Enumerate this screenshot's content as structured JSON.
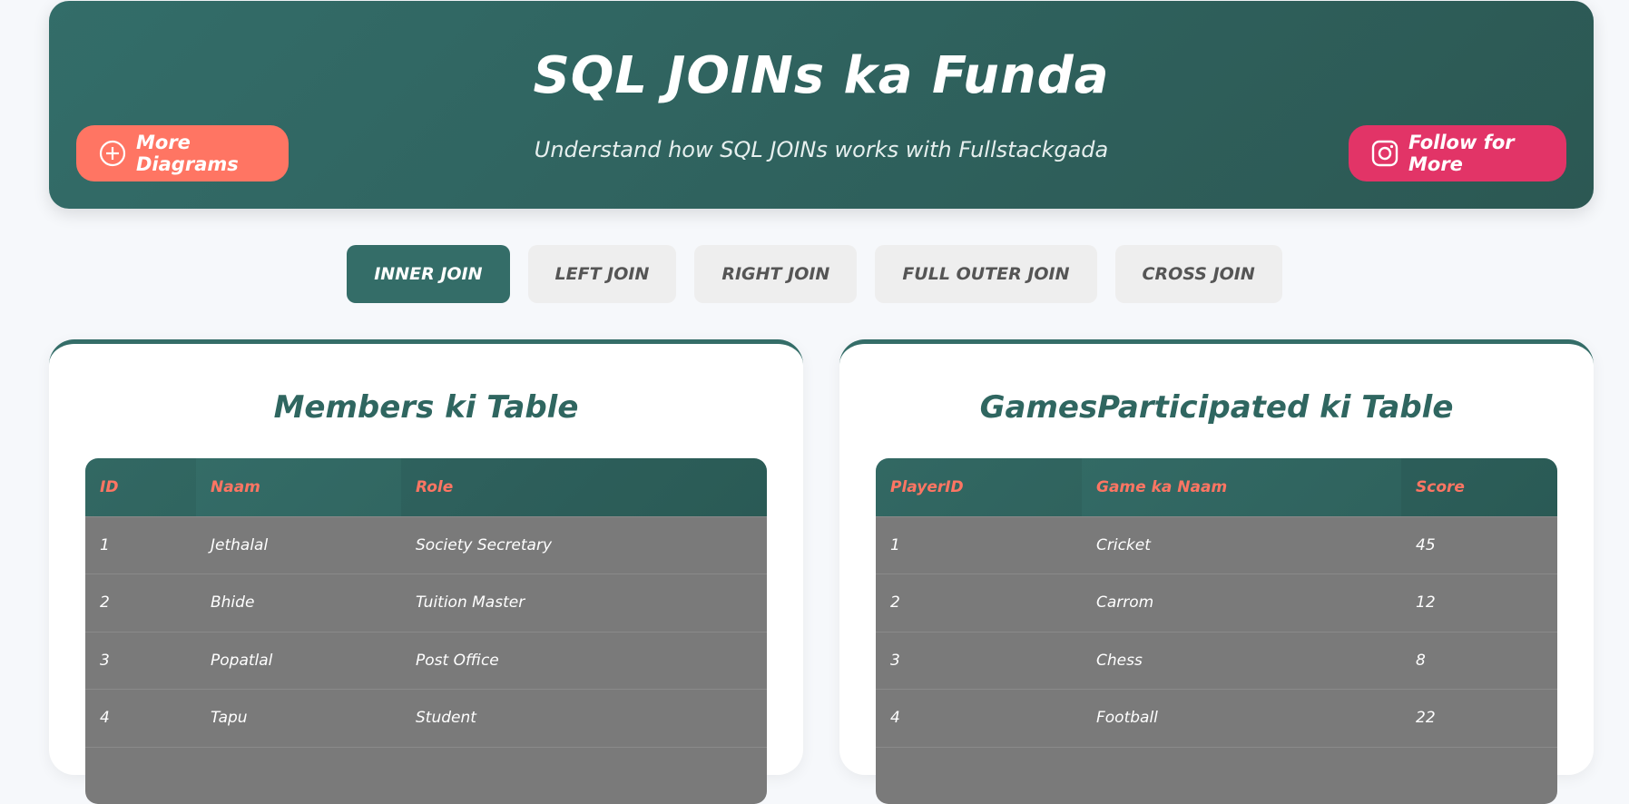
{
  "header": {
    "title": "SQL JOINs ka Funda",
    "subtitle": "Understand how SQL JOINs works with Fullstackgada",
    "more_diagrams_label": "More Diagrams",
    "follow_label": "Follow for More"
  },
  "tabs": [
    {
      "label": "INNER JOIN",
      "active": true
    },
    {
      "label": "LEFT JOIN",
      "active": false
    },
    {
      "label": "RIGHT JOIN",
      "active": false
    },
    {
      "label": "FULL OUTER JOIN",
      "active": false
    },
    {
      "label": "CROSS JOIN",
      "active": false
    }
  ],
  "members_table": {
    "title": "Members ki Table",
    "columns": [
      "ID",
      "Naam",
      "Role"
    ],
    "rows": [
      [
        "1",
        "Jethalal",
        "Society Secretary"
      ],
      [
        "2",
        "Bhide",
        "Tuition Master"
      ],
      [
        "3",
        "Popatlal",
        "Post Office"
      ],
      [
        "4",
        "Tapu",
        "Student"
      ]
    ]
  },
  "games_table": {
    "title": "GamesParticipated ki Table",
    "columns": [
      "PlayerID",
      "Game ka Naam",
      "Score"
    ],
    "rows": [
      [
        "1",
        "Cricket",
        "45"
      ],
      [
        "2",
        "Carrom",
        "12"
      ],
      [
        "3",
        "Chess",
        "8"
      ],
      [
        "4",
        "Football",
        "22"
      ]
    ]
  },
  "colors": {
    "primary": "#346d68",
    "accent": "#ff7563",
    "instagram": "#e23467"
  },
  "icons": {
    "more_diagrams": "plus-circle-icon",
    "follow": "instagram-icon"
  }
}
